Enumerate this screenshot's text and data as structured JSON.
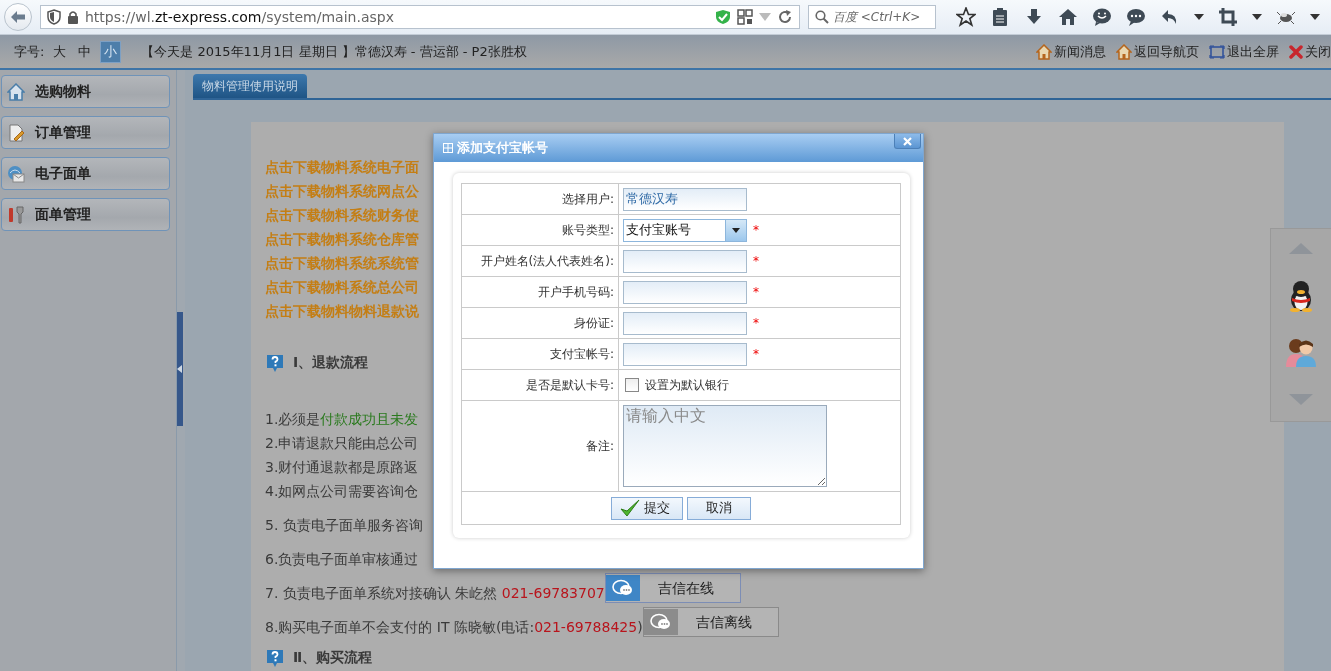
{
  "browser": {
    "url": {
      "prefix": "https://wl.",
      "domain": "zt-express.com",
      "path": "/system/main.aspx"
    },
    "search_placeholder": "百度 <Ctrl+K>"
  },
  "header": {
    "font_size_label": "字号:",
    "font_sizes": [
      {
        "label": "大",
        "selected": false
      },
      {
        "label": "中",
        "selected": false
      },
      {
        "label": "小",
        "selected": true
      }
    ],
    "info": "【今天是 2015年11月1日 星期日 】常德汉寿 - 营运部 - P2张胜权",
    "links": [
      {
        "label": "新闻消息",
        "kind": "home"
      },
      {
        "label": "返回导航页",
        "kind": "home"
      },
      {
        "label": "退出全屏",
        "kind": "fullscreen"
      },
      {
        "label": "关闭",
        "kind": "close"
      }
    ]
  },
  "sidebar": {
    "items": [
      {
        "label": "选购物料",
        "kind": "home"
      },
      {
        "label": "订单管理",
        "kind": "edit"
      },
      {
        "label": "电子面单",
        "kind": "mail"
      },
      {
        "label": "面单管理",
        "kind": "tools"
      }
    ]
  },
  "tabs": [
    {
      "label": "物料管理使用说明",
      "selected": true
    }
  ],
  "content": {
    "downloads": [
      "点击下载物料系统电子面",
      "点击下载物料系统网点公",
      "点击下载物料系统财务使",
      "点击下载物料系统仓库管",
      "点击下载物料系统系统管",
      "点击下载物料系统总公司",
      "点击下载物料物料退款说"
    ],
    "section_1_title": "Ⅰ、退款流程",
    "lines": [
      {
        "parts": [
          {
            "text": "1.必须是",
            "kind": "text"
          },
          {
            "text": "付款成功且未发",
            "kind": "success"
          }
        ]
      },
      {
        "parts": [
          {
            "text": "2.申请退款只能由总公司",
            "kind": "text"
          }
        ]
      },
      {
        "parts": [
          {
            "text": "3.财付通退款都是原路返",
            "kind": "text"
          }
        ]
      },
      {
        "parts": [
          {
            "text": "4.如网点公司需要咨询仓",
            "kind": "text"
          }
        ]
      },
      {
        "parts": [
          {
            "text": "5. 负责电子面单服务咨询",
            "kind": "text"
          }
        ]
      },
      {
        "parts": [
          {
            "text": "6.负责电子面单审核通过",
            "kind": "text"
          }
        ]
      },
      {
        "parts": [
          {
            "text": "7. 负责电子面单系统对接确认 朱屹然 ",
            "kind": "text"
          },
          {
            "text": "021-69783707",
            "kind": "phone"
          }
        ],
        "button": {
          "label": "吉信在线",
          "online": true
        }
      },
      {
        "parts": [
          {
            "text": "8.购买电子面单不会支付的 IT 陈晓敏(电话:",
            "kind": "text"
          },
          {
            "text": "021-69788425",
            "kind": "phone"
          },
          {
            "text": ")",
            "kind": "text"
          }
        ],
        "button": {
          "label": "吉信离线",
          "online": false
        }
      }
    ],
    "section_2_title": "Ⅱ、购买流程"
  },
  "modal": {
    "title": "添加支付宝帐号",
    "rows": [
      {
        "label": "选择用户:",
        "kind": "text",
        "value": "常德汉寿"
      },
      {
        "label": "账号类型:",
        "kind": "select",
        "value": "支付宝账号",
        "required_mark": "*"
      },
      {
        "label": "开户姓名(法人代表姓名):",
        "kind": "text",
        "required_mark": "*"
      },
      {
        "label": "开户手机号码:",
        "kind": "text",
        "required_mark": "*"
      },
      {
        "label": "身份证:",
        "kind": "text",
        "required_mark": "*"
      },
      {
        "label": "支付宝帐号:",
        "kind": "text",
        "required_mark": "*"
      },
      {
        "label": "是否是默认卡号:",
        "kind": "checkbox",
        "checked": false,
        "option": "设置为默认银行"
      },
      {
        "label": "备注:",
        "kind": "textarea",
        "placeholder": "请输入中文"
      }
    ],
    "buttons": [
      {
        "label": "提交",
        "kind": "submit"
      },
      {
        "label": "取消",
        "kind": "cancel"
      }
    ]
  }
}
